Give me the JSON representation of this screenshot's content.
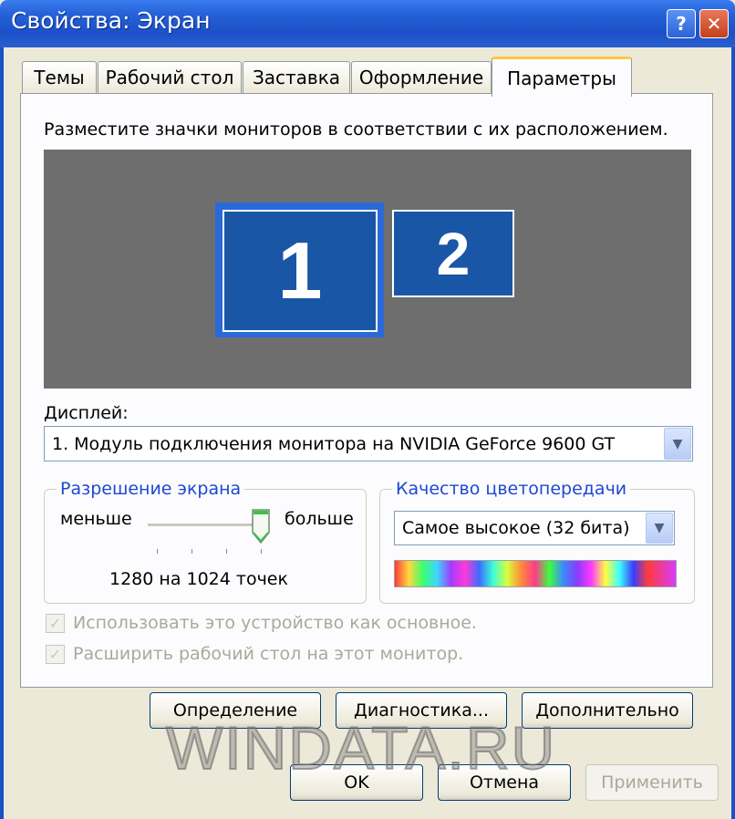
{
  "window": {
    "title": "Свойства: Экран"
  },
  "tabs": [
    {
      "label": "Темы"
    },
    {
      "label": "Рабочий стол"
    },
    {
      "label": "Заставка"
    },
    {
      "label": "Оформление"
    },
    {
      "label": "Параметры",
      "active": true
    }
  ],
  "monitors": {
    "instruction": "Разместите значки мониторов в соответствии с их расположением.",
    "monitor1": "1",
    "monitor2": "2"
  },
  "display": {
    "label": "Дисплей:",
    "value": "1. Модуль подключения монитора на NVIDIA GeForce 9600 GT"
  },
  "resolution": {
    "title": "Разрешение экрана",
    "less": "меньше",
    "more": "больше",
    "value": "1280 на 1024 точек"
  },
  "color_quality": {
    "title": "Качество цветопередачи",
    "value": "Самое высокое (32 бита)"
  },
  "checkboxes": {
    "primary": "Использовать это устройство как основное.",
    "extend": "Расширить рабочий стол на этот монитор."
  },
  "buttons": {
    "identify": "Определение",
    "troubleshoot": "Диагностика...",
    "advanced": "Дополнительно",
    "ok": "OK",
    "cancel": "Отмена",
    "apply": "Применить"
  },
  "watermark": "WINDATA.RU",
  "colors": {
    "titlebar": "#2561d8",
    "monitor_fill": "#1a56a6",
    "monitor_area": "#6e6e6e",
    "group_title": "#1f48d0",
    "active_tab_highlight": "#ffc83c"
  }
}
